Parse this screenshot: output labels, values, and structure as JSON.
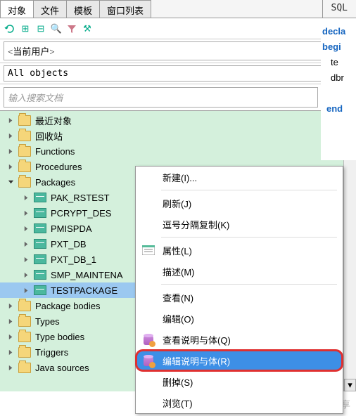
{
  "tabs": {
    "active": "对象",
    "others": [
      "文件",
      "模板",
      "窗口列表"
    ],
    "sql": "SQL"
  },
  "toolbar": {},
  "user_dropdown": "<当前用户>",
  "filter_dropdown": "All objects",
  "search": {
    "placeholder": "输入搜索文档"
  },
  "tree": {
    "recent": "最近对象",
    "recycle": "回收站",
    "functions": "Functions",
    "procedures": "Procedures",
    "packages": "Packages",
    "pkg_items": [
      "PAK_RSTEST",
      "PCRYPT_DES",
      "PMISPDA",
      "PXT_DB",
      "PXT_DB_1",
      "SMP_MAINTENA",
      "TESTPACKAGE"
    ],
    "package_bodies": "Package bodies",
    "types": "Types",
    "type_bodies": "Type bodies",
    "triggers": "Triggers",
    "java_sources": "Java sources"
  },
  "code": {
    "l1": "decla",
    "l2": "begi",
    "l3": "te",
    "l4": "dbr",
    "l5": "end"
  },
  "menu": {
    "new": "新建(I)...",
    "refresh": "刷新(J)",
    "copy": "逗号分隔复制(K)",
    "props": "属性(L)",
    "desc": "描述(M)",
    "view": "查看(N)",
    "edit": "编辑(O)",
    "viewspec": "查看说明与体(Q)",
    "editspec": "编辑说明与体(R)",
    "delete": "删掉(S)",
    "browse": "浏览(T)"
  },
  "watermark": "微卡智享"
}
